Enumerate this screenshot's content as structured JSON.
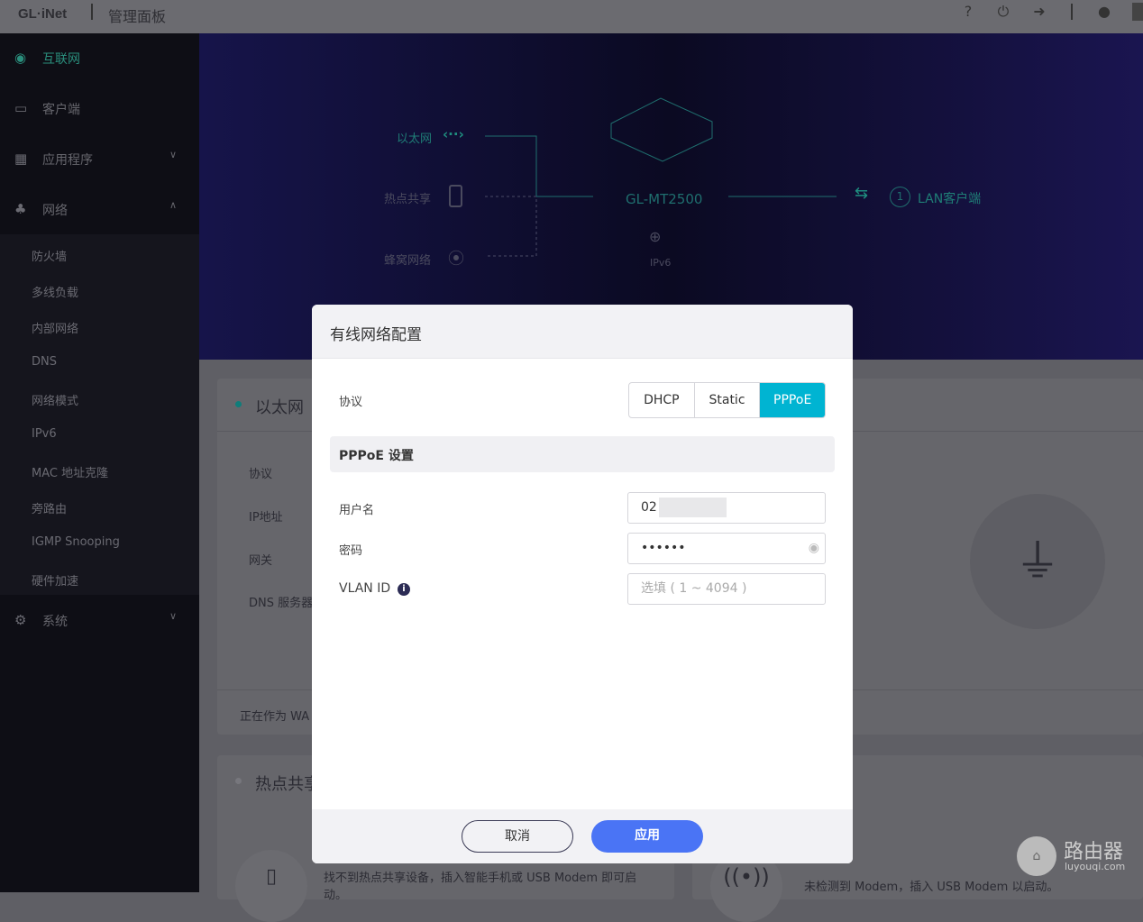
{
  "header": {
    "logo": "GL·iNet",
    "title": "管理面板",
    "icons": [
      "help-icon",
      "power-icon",
      "logout-icon",
      "palette-icon",
      "language-icon"
    ]
  },
  "sidebar": {
    "items": [
      {
        "label": "互联网",
        "icon": "globe-icon",
        "active": true
      },
      {
        "label": "客户端",
        "icon": "devices-icon"
      },
      {
        "label": "应用程序",
        "icon": "apps-icon"
      },
      {
        "label": "网络",
        "icon": "network-icon"
      }
    ],
    "sub": [
      "防火墙",
      "多线负载",
      "内部网络",
      "DNS",
      "网络模式",
      "IPv6",
      "MAC 地址克隆",
      "旁路由",
      "IGMP Snooping",
      "硬件加速"
    ],
    "system": "系统"
  },
  "banner": {
    "ethernet": "以太网",
    "hotspot": "热点共享",
    "cellular": "蜂窝网络",
    "device": "GL-MT2500",
    "ipv6": "IPv6",
    "lan_count": "1",
    "lan_label": "LAN客户端"
  },
  "ethernet_card": {
    "title": "以太网",
    "rows": [
      "协议",
      "IP地址",
      "网关",
      "DNS 服务器"
    ],
    "footer": "正在作为 WA"
  },
  "hotspot_card": {
    "title": "热点共享",
    "text": "找不到热点共享设备，插入智能手机或 USB Modem 即可启动。"
  },
  "modem_card": {
    "text": "未检测到 Modem，插入 USB Modem 以启动。"
  },
  "modal": {
    "title": "有线网络配置",
    "protocol_label": "协议",
    "protocols": [
      "DHCP",
      "Static",
      "PPPoE"
    ],
    "selected": "PPPoE",
    "section": "PPPoE 设置",
    "username_label": "用户名",
    "username": "02",
    "password_label": "密码",
    "password": "••••••",
    "vlan_label": "VLAN ID",
    "vlan_placeholder": "选填 ( 1 ~ 4094 )",
    "cancel": "取消",
    "apply": "应用"
  },
  "colors": {
    "accent": "#00b4d2",
    "apply": "#4a74f5"
  },
  "watermark": {
    "title": "路由器",
    "url": "luyouqi.com"
  }
}
